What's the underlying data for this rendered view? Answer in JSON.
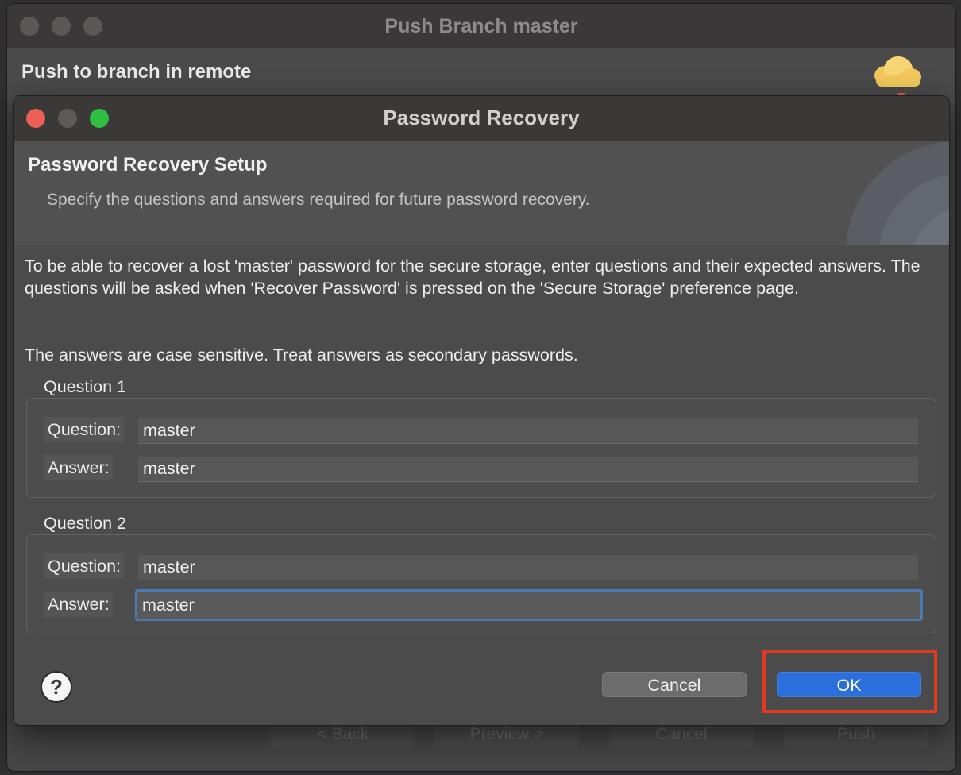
{
  "background_window": {
    "title": "Push Branch master",
    "heading": "Push to branch in remote",
    "buttons": {
      "back": "< Back",
      "preview": "Preview >",
      "cancel": "Cancel",
      "push": "Push"
    }
  },
  "dialog": {
    "title": "Password Recovery",
    "banner": {
      "title": "Password Recovery Setup",
      "description": "Specify the questions and answers required for future password recovery."
    },
    "intro": "To be able to recover a lost 'master' password for the secure storage, enter questions and their expected answers. The questions will be asked when 'Recover Password' is pressed on the 'Secure Storage' preference page.",
    "note": "The answers are case sensitive. Treat answers as secondary passwords.",
    "groups": [
      {
        "label": "Question 1",
        "question_label": "Question:",
        "question_value": "master",
        "answer_label": "Answer:",
        "answer_value": "master"
      },
      {
        "label": "Question 2",
        "question_label": "Question:",
        "question_value": "master",
        "answer_label": "Answer:",
        "answer_value": "master"
      }
    ],
    "help_icon": "question-mark-icon",
    "buttons": {
      "cancel": "Cancel",
      "ok": "OK"
    }
  },
  "colors": {
    "accent_ok": "#2a6fdb",
    "focus_ring": "#4a7bb0",
    "highlight_box": "#e23a22",
    "close_red": "#ec5f57",
    "zoom_green": "#2fc043"
  }
}
